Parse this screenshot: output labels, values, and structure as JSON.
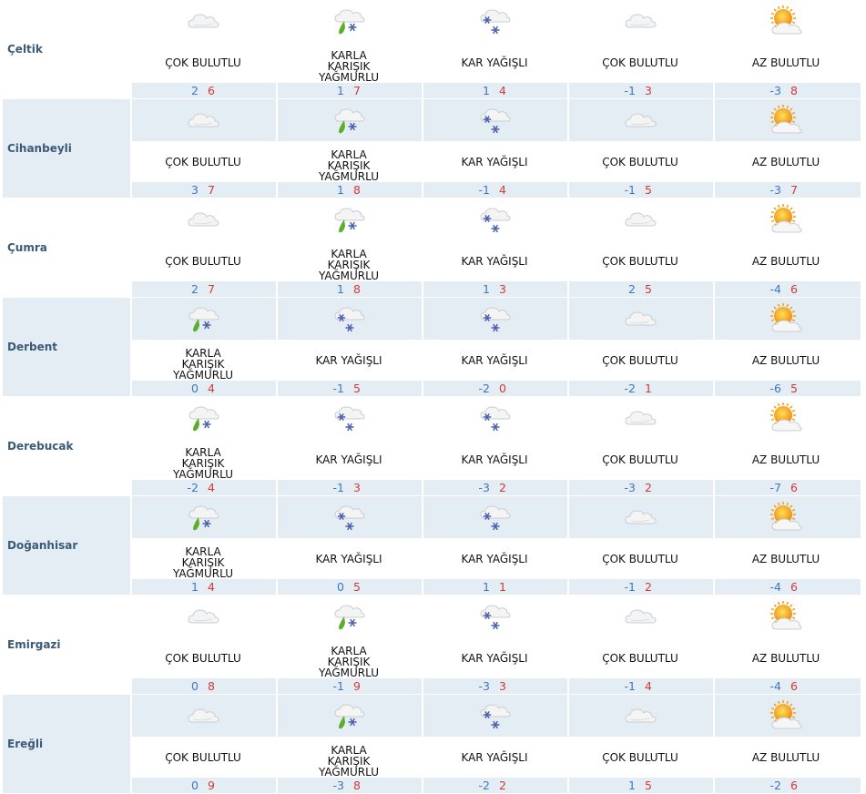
{
  "cities": [
    {
      "name": "Çeltik",
      "days": [
        {
          "icon": "cloud-icon",
          "condition": "ÇOK BULUTLU",
          "min": "2",
          "max": "6"
        },
        {
          "icon": "sleet-icon",
          "condition": "KARLA KARIŞIK YAĞMURLU",
          "min": "1",
          "max": "7"
        },
        {
          "icon": "snow-icon",
          "condition": "KAR YAĞIŞLI",
          "min": "1",
          "max": "4"
        },
        {
          "icon": "cloud-icon",
          "condition": "ÇOK BULUTLU",
          "min": "-1",
          "max": "3"
        },
        {
          "icon": "partly-sunny-icon",
          "condition": "AZ BULUTLU",
          "min": "-3",
          "max": "8"
        }
      ]
    },
    {
      "name": "Cihanbeyli",
      "days": [
        {
          "icon": "cloud-icon",
          "condition": "ÇOK BULUTLU",
          "min": "3",
          "max": "7"
        },
        {
          "icon": "sleet-icon",
          "condition": "KARLA KARIŞIK YAĞMURLU",
          "min": "1",
          "max": "8"
        },
        {
          "icon": "snow-icon",
          "condition": "KAR YAĞIŞLI",
          "min": "-1",
          "max": "4"
        },
        {
          "icon": "cloud-icon",
          "condition": "ÇOK BULUTLU",
          "min": "-1",
          "max": "5"
        },
        {
          "icon": "partly-sunny-icon",
          "condition": "AZ BULUTLU",
          "min": "-3",
          "max": "7"
        }
      ]
    },
    {
      "name": "Çumra",
      "days": [
        {
          "icon": "cloud-icon",
          "condition": "ÇOK BULUTLU",
          "min": "2",
          "max": "7"
        },
        {
          "icon": "sleet-icon",
          "condition": "KARLA KARIŞIK YAĞMURLU",
          "min": "1",
          "max": "8"
        },
        {
          "icon": "snow-icon",
          "condition": "KAR YAĞIŞLI",
          "min": "1",
          "max": "3"
        },
        {
          "icon": "cloud-icon",
          "condition": "ÇOK BULUTLU",
          "min": "2",
          "max": "5"
        },
        {
          "icon": "partly-sunny-icon",
          "condition": "AZ BULUTLU",
          "min": "-4",
          "max": "6"
        }
      ]
    },
    {
      "name": "Derbent",
      "days": [
        {
          "icon": "sleet-icon",
          "condition": "KARLA KARIŞIK YAĞMURLU",
          "min": "0",
          "max": "4"
        },
        {
          "icon": "snow-icon",
          "condition": "KAR YAĞIŞLI",
          "min": "-1",
          "max": "5"
        },
        {
          "icon": "snow-icon",
          "condition": "KAR YAĞIŞLI",
          "min": "-2",
          "max": "0"
        },
        {
          "icon": "cloud-icon",
          "condition": "ÇOK BULUTLU",
          "min": "-2",
          "max": "1"
        },
        {
          "icon": "partly-sunny-icon",
          "condition": "AZ BULUTLU",
          "min": "-6",
          "max": "5"
        }
      ]
    },
    {
      "name": "Derebucak",
      "days": [
        {
          "icon": "sleet-icon",
          "condition": "KARLA KARIŞIK YAĞMURLU",
          "min": "-2",
          "max": "4"
        },
        {
          "icon": "snow-icon",
          "condition": "KAR YAĞIŞLI",
          "min": "-1",
          "max": "3"
        },
        {
          "icon": "snow-icon",
          "condition": "KAR YAĞIŞLI",
          "min": "-3",
          "max": "2"
        },
        {
          "icon": "cloud-icon",
          "condition": "ÇOK BULUTLU",
          "min": "-3",
          "max": "2"
        },
        {
          "icon": "partly-sunny-icon",
          "condition": "AZ BULUTLU",
          "min": "-7",
          "max": "6"
        }
      ]
    },
    {
      "name": "Doğanhisar",
      "days": [
        {
          "icon": "sleet-icon",
          "condition": "KARLA KARIŞIK YAĞMURLU",
          "min": "1",
          "max": "4"
        },
        {
          "icon": "snow-icon",
          "condition": "KAR YAĞIŞLI",
          "min": "0",
          "max": "5"
        },
        {
          "icon": "snow-icon",
          "condition": "KAR YAĞIŞLI",
          "min": "1",
          "max": "1"
        },
        {
          "icon": "cloud-icon",
          "condition": "ÇOK BULUTLU",
          "min": "-1",
          "max": "2"
        },
        {
          "icon": "partly-sunny-icon",
          "condition": "AZ BULUTLU",
          "min": "-4",
          "max": "6"
        }
      ]
    },
    {
      "name": "Emirgazi",
      "days": [
        {
          "icon": "cloud-icon",
          "condition": "ÇOK BULUTLU",
          "min": "0",
          "max": "8"
        },
        {
          "icon": "sleet-icon",
          "condition": "KARLA KARIŞIK YAĞMURLU",
          "min": "-1",
          "max": "9"
        },
        {
          "icon": "snow-icon",
          "condition": "KAR YAĞIŞLI",
          "min": "-3",
          "max": "3"
        },
        {
          "icon": "cloud-icon",
          "condition": "ÇOK BULUTLU",
          "min": "-1",
          "max": "4"
        },
        {
          "icon": "partly-sunny-icon",
          "condition": "AZ BULUTLU",
          "min": "-4",
          "max": "6"
        }
      ]
    },
    {
      "name": "Ereğli",
      "days": [
        {
          "icon": "cloud-icon",
          "condition": "ÇOK BULUTLU",
          "min": "0",
          "max": "9"
        },
        {
          "icon": "sleet-icon",
          "condition": "KARLA KARIŞIK YAĞMURLU",
          "min": "-3",
          "max": "8"
        },
        {
          "icon": "snow-icon",
          "condition": "KAR YAĞIŞLI",
          "min": "-2",
          "max": "2"
        },
        {
          "icon": "cloud-icon",
          "condition": "ÇOK BULUTLU",
          "min": "1",
          "max": "5"
        },
        {
          "icon": "partly-sunny-icon",
          "condition": "AZ BULUTLU",
          "min": "-2",
          "max": "6"
        }
      ]
    }
  ],
  "colors": {
    "min_temp": "#3d78c0",
    "max_temp": "#d23a3a",
    "city": "#3b5a78",
    "row_band": "#e4edf4"
  }
}
